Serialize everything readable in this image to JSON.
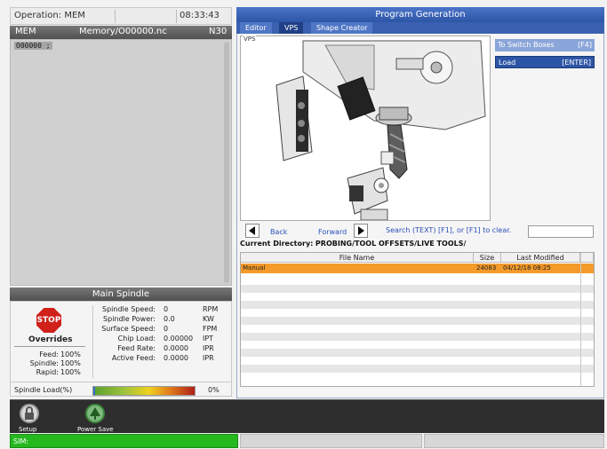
{
  "top_bar": {
    "operation": "Operation: MEM",
    "clock": "08:33:43"
  },
  "memory_header": {
    "mode": "MEM",
    "file": "Memory/O00000.nc",
    "line": "N30"
  },
  "editor": {
    "line1": "O00000 ;"
  },
  "spindle": {
    "title": "Main Spindle",
    "stop_label": "STOP",
    "overrides_title": "Overrides",
    "overrides": [
      {
        "label": "Feed:",
        "value": "100%"
      },
      {
        "label": "Spindle:",
        "value": "100%"
      },
      {
        "label": "Rapid:",
        "value": "100%"
      }
    ],
    "metrics": [
      {
        "label": "Spindle Speed:",
        "value": "0",
        "unit": "RPM"
      },
      {
        "label": "Spindle Power:",
        "value": "0.0",
        "unit": "KW"
      },
      {
        "label": "Surface Speed:",
        "value": "0",
        "unit": "FPM"
      },
      {
        "label": "Chip Load:",
        "value": "0.00000",
        "unit": "IPT"
      },
      {
        "label": "Feed Rate:",
        "value": "0.0000",
        "unit": "IPR"
      },
      {
        "label": "Active Feed:",
        "value": "0.0000",
        "unit": "IPR"
      }
    ],
    "load_label": "Spindle Load(%)",
    "load_value": "0%",
    "load_fraction": 0.0
  },
  "program_generation": {
    "title": "Program Generation",
    "tabs": [
      "Editor",
      "VPS",
      "Shape Creator"
    ],
    "active_tab": "VPS",
    "vps_label": "VPS",
    "switch_button": {
      "label": "To Switch Boxes",
      "key": "[F4]"
    },
    "load_button": {
      "label": "Load",
      "key": "[ENTER]"
    },
    "nav": {
      "back": "Back",
      "forward": "Forward",
      "search_hint": "Search (TEXT) [F1], or [F1] to clear."
    },
    "current_dir_label": "Current Directory:",
    "current_dir": "PROBING/TOOL OFFSETS/LIVE TOOLS/",
    "table": {
      "headers": [
        "File Name",
        "Size",
        "Last Modified"
      ],
      "rows": [
        {
          "name": "Manual",
          "size": "24083",
          "modified": "04/12/18 08:25"
        }
      ]
    }
  },
  "bottom": {
    "setup_label": "Setup",
    "power_save_label": "Power Save",
    "status": "SIM:"
  },
  "colors": {
    "accent_blue": "#2d55a6",
    "selected_row": "#f39a2a",
    "status_green": "#25b81f",
    "stop_red": "#d0201a"
  }
}
